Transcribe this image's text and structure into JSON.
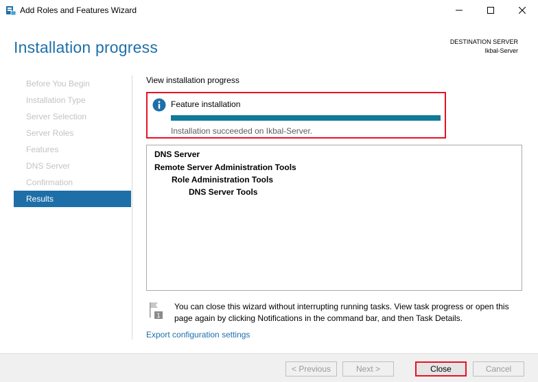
{
  "window": {
    "title": "Add Roles and Features Wizard"
  },
  "header": {
    "heading": "Installation progress",
    "destination_label": "DESTINATION SERVER",
    "destination_value": "Ikbal-Server"
  },
  "nav": {
    "items": [
      {
        "label": "Before You Begin",
        "active": false
      },
      {
        "label": "Installation Type",
        "active": false
      },
      {
        "label": "Server Selection",
        "active": false
      },
      {
        "label": "Server Roles",
        "active": false
      },
      {
        "label": "Features",
        "active": false
      },
      {
        "label": "DNS Server",
        "active": false
      },
      {
        "label": "Confirmation",
        "active": false
      },
      {
        "label": "Results",
        "active": true
      }
    ]
  },
  "main": {
    "section_label": "View installation progress",
    "progress": {
      "title": "Feature installation",
      "status": "Installation succeeded on Ikbal-Server.",
      "percent": 100
    },
    "results": {
      "item_0": "DNS Server",
      "item_1": "Remote Server Administration Tools",
      "item_2": "Role Administration Tools",
      "item_3": "DNS Server Tools"
    },
    "notice": "You can close this wizard without interrupting running tasks. View task progress or open this page again by clicking Notifications in the command bar, and then Task Details.",
    "export_link": "Export configuration settings"
  },
  "footer": {
    "previous": "< Previous",
    "next": "Next >",
    "close": "Close",
    "cancel": "Cancel"
  },
  "colors": {
    "accent": "#1e6fa8",
    "progress_fill": "#0f7b99",
    "highlight": "#e81123"
  }
}
